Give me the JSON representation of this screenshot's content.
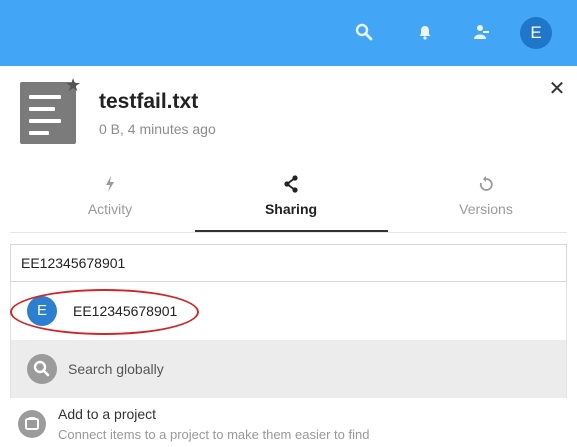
{
  "topbar": {
    "icons": [
      "search-icon",
      "notifications-icon",
      "contacts-icon"
    ],
    "user_initial": "E",
    "background": "#42a5f5"
  },
  "file": {
    "name": "testfail.txt",
    "meta": "0 B, 4 minutes ago",
    "favorite": true
  },
  "tabs": [
    {
      "label": "Activity",
      "icon": "activity-icon"
    },
    {
      "label": "Sharing",
      "icon": "share-icon",
      "active": true
    },
    {
      "label": "Versions",
      "icon": "history-icon"
    }
  ],
  "share": {
    "input_value": "EE12345678901",
    "results": [
      {
        "initial": "E",
        "label": "EE12345678901"
      }
    ],
    "global_search_label": "Search globally"
  },
  "project": {
    "title": "Add to a project",
    "description": "Connect items to a project to make them easier to find"
  },
  "colors": {
    "accent": "#42a5f5",
    "avatar": "#1f77c9",
    "highlight_circle": "#d0262a"
  }
}
